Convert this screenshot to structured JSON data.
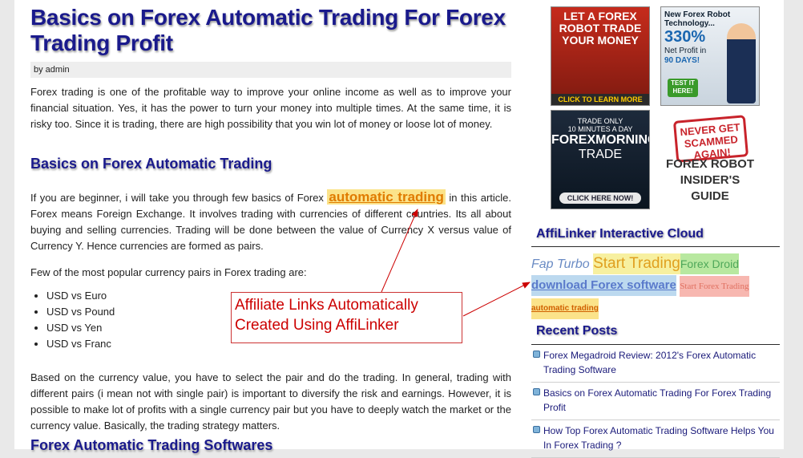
{
  "post": {
    "title": "Basics on Forex Automatic Trading For Forex Trading Profit",
    "byline": "by admin",
    "intro": "Forex trading is one of the profitable way to improve your online income as well as to improve your financial situation. Yes, it has the power to turn your money into multiple times. At the same time, it is risky too. Since it is trading, there are high possibility that you win lot of money or loose lot of money.",
    "section1_heading": "Basics on Forex Automatic Trading",
    "para2_before": "If you are beginner, i will take you through few basics of Forex ",
    "para2_link": "automatic trading",
    "para2_after": " in this article. Forex means Foreign Exchange. It involves trading with currencies of different countries. Its all about buying and selling currencies. Trading will be done between the value of Currency X versus value of Currency Y. Hence currencies are formed as pairs.",
    "pairs_intro": "Few of the most popular currency pairs in Forex trading are:",
    "pairs": [
      "USD vs Euro",
      "USD vs Pound",
      "USD vs Yen",
      "USD vs Franc"
    ],
    "para4": "Based on the currency value, you have to select the pair and do the trading. In general, trading with different pairs (i mean not with single pair) is important to diversify the risk and earnings. However, it is possible to make lot of profits with a single currency pair but you have to deeply watch the market or the currency value. Basically, the trading strategy matters.",
    "section2_heading": "Forex Automatic Trading Softwares"
  },
  "callout": {
    "line1": "Affiliate Links Automatically",
    "line2": "Created Using AffiLinker",
    "color": "#cc0000"
  },
  "ads": {
    "ad1": {
      "text": "LET A FOREX ROBOT TRADE YOUR MONEY",
      "cta": "CLICK TO LEARN MORE"
    },
    "ad2": {
      "text": "New Forex Robot Technology...",
      "big": "330%",
      "sub1": "Net Profit in",
      "sub2": "90 DAYS!",
      "cta": "TEST IT HERE!"
    },
    "ad3": {
      "line1": "TRADE ONLY",
      "line2": "10 MINUTES A DAY",
      "name1": "FOREXMORNING",
      "name2": "TRADE",
      "cta": "CLICK HERE NOW!"
    },
    "ad4": {
      "stamp": "NEVER GET SCAMMED AGAIN!",
      "title1": "FOREX ROBOT",
      "title2": "INSIDER'S GUIDE"
    }
  },
  "sidebar": {
    "cloud_title": "AffiLinker Interactive Cloud",
    "cloud_tags": [
      "Fap Turbo",
      "Start Trading",
      "Forex Droid",
      "download Forex software",
      "Start Forex Trading",
      "automatic trading"
    ],
    "recent_title": "Recent Posts",
    "recent_posts": [
      "Forex Megadroid Review: 2012's Forex Automatic Trading Software",
      "Basics on Forex Automatic Trading For Forex Trading Profit",
      "How Top Forex Automatic Trading Software Helps You In Forex Trading ?"
    ]
  },
  "colors": {
    "heading": "#1a1a8c",
    "highlight_bg": "#fbe38a",
    "highlight_text": "#e07b00"
  }
}
